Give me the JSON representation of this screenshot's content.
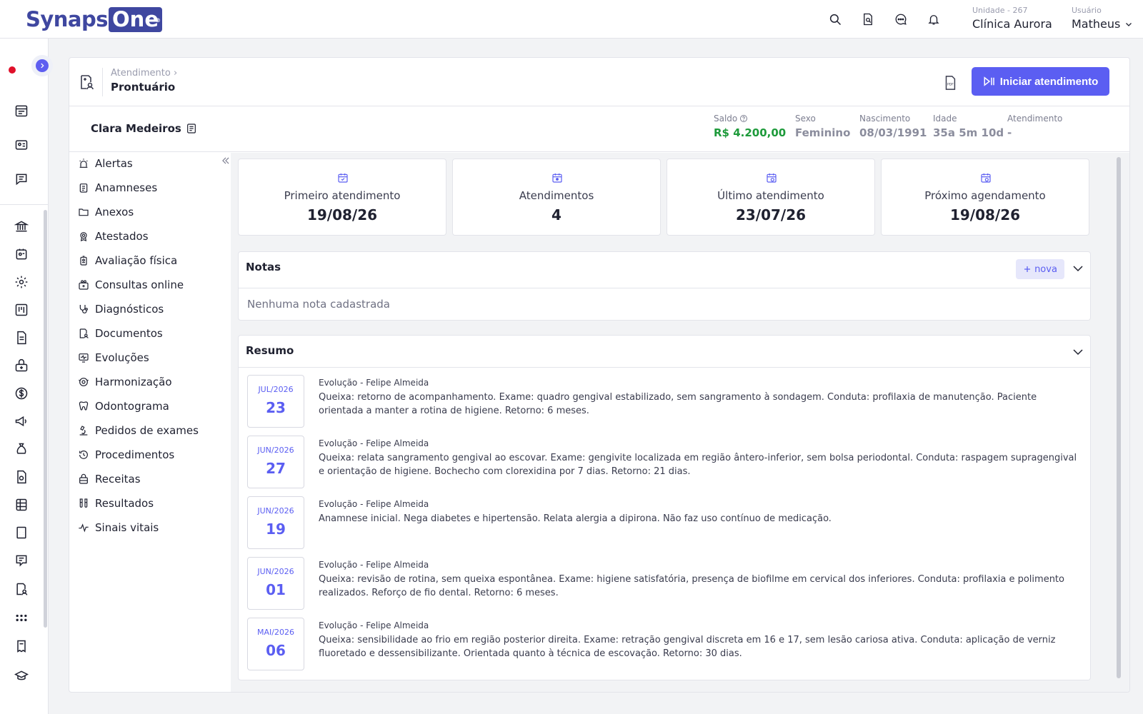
{
  "brand": {
    "part1": "Synaps",
    "part2": "One",
    "reg": "®"
  },
  "top": {
    "unit_label": "Unidade - 267",
    "unit_value": "Clínica Aurora",
    "user_label": "Usuário",
    "user_value": "Matheus",
    "icons": [
      "search-icon",
      "document-search-icon",
      "chat-icon",
      "bell-icon"
    ]
  },
  "header": {
    "breadcrumb": "Atendimento",
    "breadcrumb_sep": "›",
    "title": "Prontuário",
    "start_button": "Iniciar atendimento"
  },
  "patient": {
    "name": "Clara Medeiros",
    "fields": [
      {
        "label": "Saldo",
        "value": "R$ 4.200,00"
      },
      {
        "label": "Sexo",
        "value": "Feminino"
      },
      {
        "label": "Nascimento",
        "value": "08/03/1991"
      },
      {
        "label": "Idade",
        "value": "35a 5m 10d"
      },
      {
        "label": "Atendimento",
        "value": "-"
      }
    ]
  },
  "menu": [
    {
      "label": "Alertas",
      "icon": "alarm-icon"
    },
    {
      "label": "Anamneses",
      "icon": "clipboard-icon"
    },
    {
      "label": "Anexos",
      "icon": "folder-icon"
    },
    {
      "label": "Atestados",
      "icon": "certificate-icon"
    },
    {
      "label": "Avaliação física",
      "icon": "body-icon"
    },
    {
      "label": "Consultas online",
      "icon": "video-icon"
    },
    {
      "label": "Diagnósticos",
      "icon": "stethoscope-icon"
    },
    {
      "label": "Documentos",
      "icon": "document-icon"
    },
    {
      "label": "Evoluções",
      "icon": "monitor-icon"
    },
    {
      "label": "Harmonização",
      "icon": "face-icon"
    },
    {
      "label": "Odontograma",
      "icon": "tooth-icon"
    },
    {
      "label": "Pedidos de exames",
      "icon": "microscope-icon"
    },
    {
      "label": "Procedimentos",
      "icon": "history-icon"
    },
    {
      "label": "Receitas",
      "icon": "pill-icon"
    },
    {
      "label": "Resultados",
      "icon": "test-tubes-icon"
    },
    {
      "label": "Sinais vitais",
      "icon": "pulse-icon"
    }
  ],
  "stats": [
    {
      "label": "Primeiro atendimento",
      "value": "19/08/26"
    },
    {
      "label": "Atendimentos",
      "value": "4"
    },
    {
      "label": "Último atendimento",
      "value": "23/07/26"
    },
    {
      "label": "Próximo agendamento",
      "value": "19/08/26"
    }
  ],
  "notes": {
    "title": "Notas",
    "new_button": "nova",
    "empty": "Nenhuma nota cadastrada"
  },
  "summary": {
    "title": "Resumo",
    "entries": [
      {
        "month": "JUL/2026",
        "day": "23",
        "title": "Evolução - Felipe Almeida",
        "text": "Queixa: retorno de acompanhamento. Exame: quadro gengival estabilizado, sem sangramento à sondagem. Conduta: profilaxia de manutenção. Paciente orientada a manter a rotina de higiene. Retorno: 6 meses."
      },
      {
        "month": "JUN/2026",
        "day": "27",
        "title": "Evolução - Felipe Almeida",
        "text": "Queixa: relata sangramento gengival ao escovar. Exame: gengivite localizada em região ântero-inferior, sem bolsa periodontal. Conduta: raspagem supragengival e orientação de higiene. Bochecho com clorexidina por 7 dias. Retorno: 21 dias."
      },
      {
        "month": "JUN/2026",
        "day": "19",
        "title": "Evolução - Felipe Almeida",
        "text": "Anamnese inicial. Nega diabetes e hipertensão. Relata alergia a dipirona. Não faz uso contínuo de medicação."
      },
      {
        "month": "JUN/2026",
        "day": "01",
        "title": "Evolução - Felipe Almeida",
        "text": "Queixa: revisão de rotina, sem queixa espontânea. Exame: higiene satisfatória, presença de biofilme em cervical dos inferiores. Conduta: profilaxia e polimento realizados. Reforço de fio dental. Retorno: 6 meses."
      },
      {
        "month": "MAI/2026",
        "day": "06",
        "title": "Evolução - Felipe Almeida",
        "text": "Queixa: sensibilidade ao frio em região posterior direita. Exame: retração gengival discreta em 16 e 17, sem lesão cariosa ativa. Conduta: aplicação de verniz fluoretado e dessensibilizante. Orientada quanto à técnica de escovação. Retorno: 30 dias."
      }
    ]
  },
  "colors": {
    "accent": "#5b5ef2",
    "brand": "#3f47a0",
    "saldo": "#1d9a3a",
    "alert_dot": "#e0102a"
  }
}
